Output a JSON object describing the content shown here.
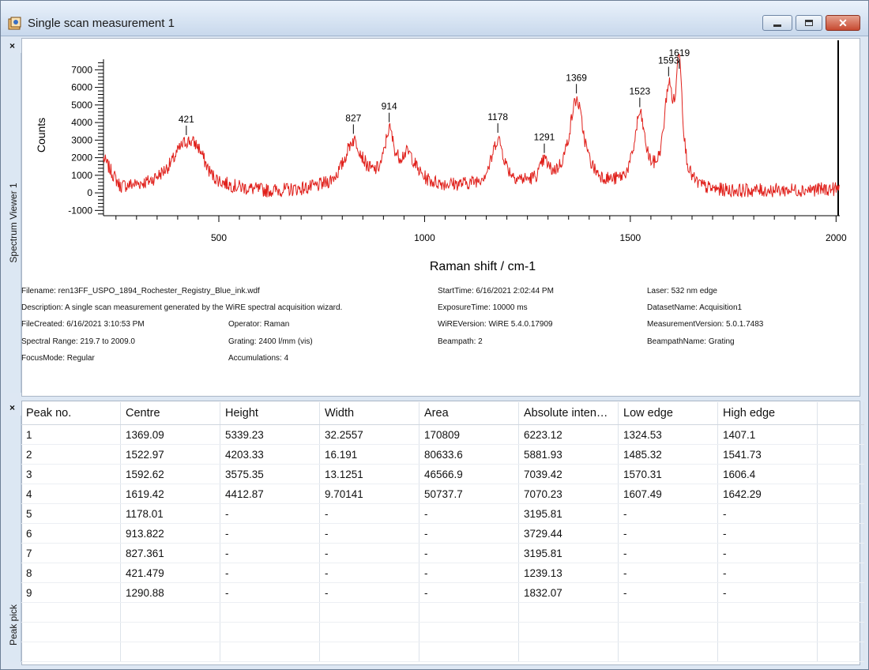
{
  "window": {
    "title": "Single scan measurement 1"
  },
  "spectrum_pane": {
    "label": "Spectrum Viewer 1",
    "close": "×"
  },
  "peak_pane": {
    "label": "Peak pick",
    "close": "×"
  },
  "meta": {
    "filename": "Filename: ren13FF_USPO_1894_Rochester_Registry_Blue_ink.wdf",
    "description": "Description: A single scan measurement generated by the WiRE spectral acquisition wizard.",
    "file_created": "FileCreated: 6/16/2021 3:10:53 PM",
    "spectral_range": "Spectral Range: 219.7 to 2009.0",
    "focus_mode": "FocusMode: Regular",
    "operator": "Operator: Raman",
    "grating": "Grating: 2400 l/mm (vis)",
    "accumulations": "Accumulations: 4",
    "start_time": "StartTime: 6/16/2021 2:02:44 PM",
    "exposure": "ExposureTime: 10000 ms",
    "wire_version": "WiREVersion: WiRE 5.4.0.17909",
    "beampath": "Beampath: 2",
    "laser": "Laser: 532 nm edge",
    "dataset": "DatasetName: Acquisition1",
    "measurement_version": "MeasurementVersion: 5.0.1.7483",
    "beampath_name": "BeampathName: Grating"
  },
  "chart_data": {
    "type": "line",
    "xlabel": "Raman shift / cm-1",
    "ylabel": "Counts",
    "xlim": [
      219.7,
      2009.0
    ],
    "ylim": [
      -1300,
      7600
    ],
    "xticks": [
      500,
      1000,
      1500,
      2000
    ],
    "yticks": [
      7000,
      6000,
      5000,
      4000,
      3000,
      2000,
      1000,
      0,
      -1000
    ],
    "series_color": "#e0201b",
    "baseline_points": [
      [
        219.7,
        1900
      ],
      [
        260,
        300
      ],
      [
        330,
        450
      ],
      [
        400,
        1100
      ],
      [
        480,
        300
      ],
      [
        620,
        0
      ],
      [
        760,
        100
      ],
      [
        1250,
        350
      ],
      [
        1700,
        0
      ],
      [
        2009,
        200
      ]
    ],
    "peaks": [
      {
        "center": 421,
        "height": 1500,
        "width": 30,
        "label": "421"
      },
      {
        "center": 450,
        "height": 1200,
        "width": 25,
        "label": ""
      },
      {
        "center": 827,
        "height": 2700,
        "width": 28,
        "label": "827"
      },
      {
        "center": 914,
        "height": 2800,
        "width": 14,
        "label": "914"
      },
      {
        "center": 960,
        "height": 1700,
        "width": 25,
        "label": ""
      },
      {
        "center": 1178,
        "height": 2600,
        "width": 18,
        "label": "1178"
      },
      {
        "center": 1291,
        "height": 1100,
        "width": 12,
        "label": "1291"
      },
      {
        "center": 1369,
        "height": 4900,
        "width": 22,
        "label": "1369"
      },
      {
        "center": 1523,
        "height": 4000,
        "width": 16,
        "label": "1523"
      },
      {
        "center": 1593,
        "height": 5200,
        "width": 14,
        "label": "1593"
      },
      {
        "center": 1619,
        "height": 6800,
        "width": 9,
        "label": "1619"
      }
    ]
  },
  "table": {
    "columns": [
      "Peak no.",
      "Centre",
      "Height",
      "Width",
      "Area",
      "Absolute inten…",
      "Low edge",
      "High edge"
    ],
    "rows": [
      [
        "1",
        "1369.09",
        "5339.23",
        "32.2557",
        "170809",
        "6223.12",
        "1324.53",
        "1407.1"
      ],
      [
        "2",
        "1522.97",
        "4203.33",
        "16.191",
        "80633.6",
        "5881.93",
        "1485.32",
        "1541.73"
      ],
      [
        "3",
        "1592.62",
        "3575.35",
        "13.1251",
        "46566.9",
        "7039.42",
        "1570.31",
        "1606.4"
      ],
      [
        "4",
        "1619.42",
        "4412.87",
        "9.70141",
        "50737.7",
        "7070.23",
        "1607.49",
        "1642.29"
      ],
      [
        "5",
        "1178.01",
        "-",
        "-",
        "-",
        "3195.81",
        "-",
        "-"
      ],
      [
        "6",
        "913.822",
        "-",
        "-",
        "-",
        "3729.44",
        "-",
        "-"
      ],
      [
        "7",
        "827.361",
        "-",
        "-",
        "-",
        "3195.81",
        "-",
        "-"
      ],
      [
        "8",
        "421.479",
        "-",
        "-",
        "-",
        "1239.13",
        "-",
        "-"
      ],
      [
        "9",
        "1290.88",
        "-",
        "-",
        "-",
        "1832.07",
        "-",
        "-"
      ]
    ]
  }
}
